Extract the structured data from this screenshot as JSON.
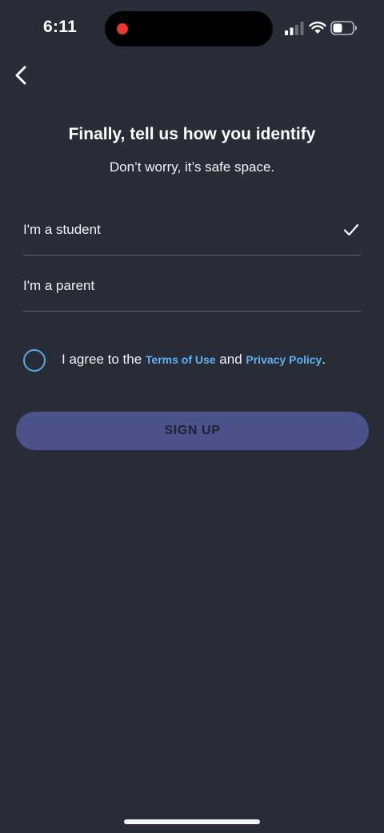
{
  "status_bar": {
    "time": "6:11",
    "icons": [
      "recording-dot",
      "cellular-signal",
      "wifi",
      "battery"
    ]
  },
  "header": {
    "back_icon": "chevron-left"
  },
  "title": "Finally, tell us how you identify",
  "subtitle": "Don’t worry, it’s safe space.",
  "options": [
    {
      "label": "I'm a student",
      "selected": true
    },
    {
      "label": "I'm a parent",
      "selected": false
    }
  ],
  "agreement": {
    "checked": false,
    "prefix": "I agree to the ",
    "terms_link": "Terms of Use",
    "middle": " and ",
    "privacy_link": "Privacy Policy",
    "suffix": "."
  },
  "signup_button": {
    "label": "SIGN UP"
  },
  "colors": {
    "background": "#282c36",
    "button": "#4b5289",
    "link": "#5fb0f0",
    "radio": "#5aa8e8",
    "record": "#e8372f"
  }
}
